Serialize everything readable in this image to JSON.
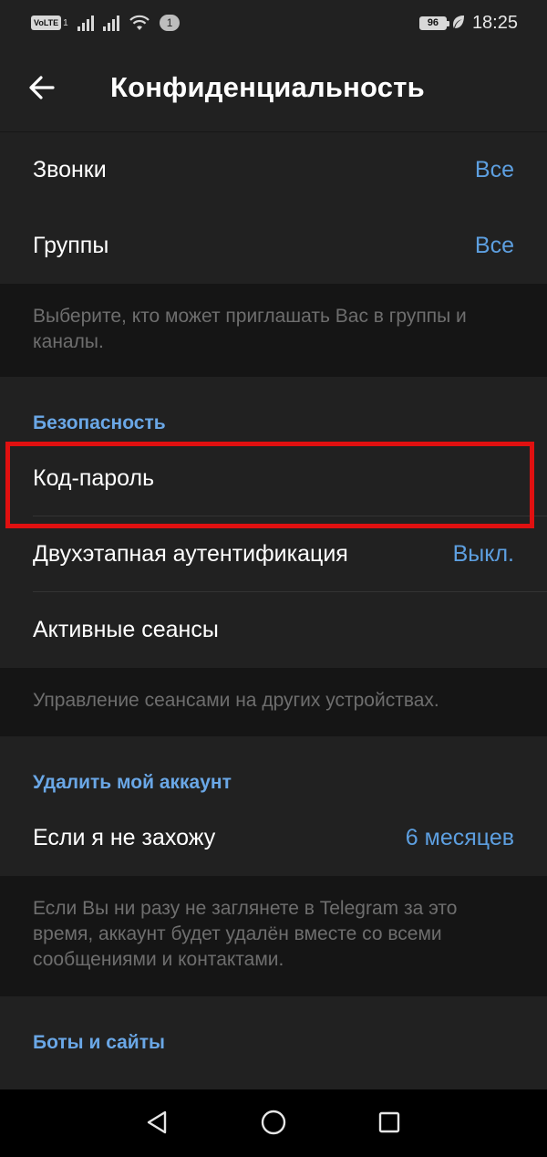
{
  "status_bar": {
    "volte": "VoLTE",
    "sim_slot": "1",
    "notification_count": "1",
    "battery": "96",
    "time": "18:25",
    "icons": [
      "signal-icon",
      "wifi-icon",
      "battery-icon",
      "leaf-icon"
    ]
  },
  "header": {
    "back_icon": "arrow-left-icon",
    "title": "Конфиденциальность"
  },
  "privacy": {
    "items": [
      {
        "label": "Звонки",
        "value": "Все"
      },
      {
        "label": "Группы",
        "value": "Все"
      }
    ],
    "hint": "Выберите, кто может приглашать Вас в группы и каналы."
  },
  "security": {
    "header": "Безопасность",
    "items": [
      {
        "label": "Код-пароль",
        "value": ""
      },
      {
        "label": "Двухэтапная аутентификация",
        "value": "Выкл."
      },
      {
        "label": "Активные сеансы",
        "value": ""
      }
    ],
    "hint": "Управление сеансами на других устройствах."
  },
  "delete_account": {
    "header": "Удалить мой аккаунт",
    "items": [
      {
        "label": "Если я не захожу",
        "value": "6 месяцев"
      }
    ],
    "hint": "Если Вы ни разу не заглянете в Telegram за это время, аккаунт будет удалён вместе со всеми сообщениями и контактами."
  },
  "bots": {
    "header": "Боты и сайты"
  },
  "colors": {
    "accent": "#5d9fe0",
    "highlight": "#e01010",
    "background": "#212121"
  },
  "nav": {
    "icons": [
      "back-triangle-icon",
      "home-circle-icon",
      "recents-square-icon"
    ]
  }
}
